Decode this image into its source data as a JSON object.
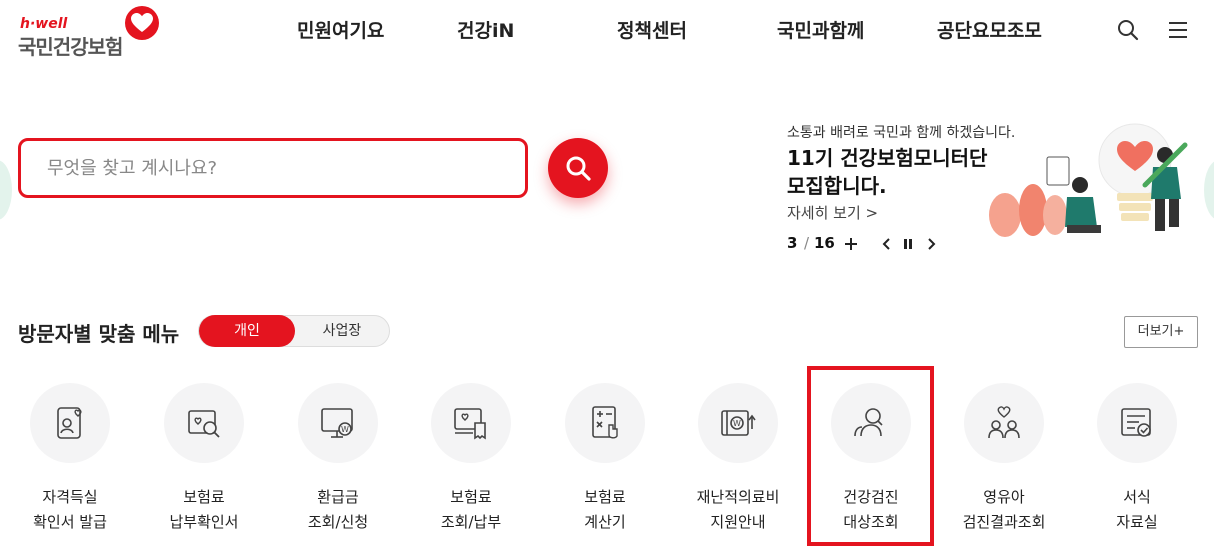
{
  "header": {
    "logo_tagline": "h·well",
    "logo_text": "국민건강보험",
    "nav": [
      "민원여기요",
      "건강iN",
      "정책센터",
      "국민과함께",
      "공단요모조모"
    ],
    "icons": [
      "search-icon",
      "hamburger-menu-icon"
    ]
  },
  "search": {
    "placeholder": "무엇을 찾고 계시나요?"
  },
  "banner": {
    "subtitle": "소통과 배려로 국민과 함께 하겠습니다.",
    "title": "11기 건강보험모니터단\n모집합니다.",
    "link": "자세히 보기 >",
    "pager_current": "3",
    "pager_sep": "/",
    "pager_total": "16"
  },
  "visitor_menu": {
    "title": "방문자별 맞춤 메뉴",
    "toggle_on": "개인",
    "toggle_off": "사업장",
    "more": "더보기+",
    "items": [
      {
        "label": "자격득실\n확인서 발급",
        "icon": "id-card-icon"
      },
      {
        "label": "보험료\n납부확인서",
        "icon": "document-search-icon"
      },
      {
        "label": "환급금\n조회/신청",
        "icon": "monitor-won-icon"
      },
      {
        "label": "보험료\n조회/납부",
        "icon": "receipt-icon"
      },
      {
        "label": "보험료\n계산기",
        "icon": "calculator-icon"
      },
      {
        "label": "재난적의료비\n지원안내",
        "icon": "won-support-icon"
      },
      {
        "label": "건강검진\n대상조회",
        "icon": "user-search-icon"
      },
      {
        "label": "영유아\n검진결과조회",
        "icon": "family-heart-icon"
      },
      {
        "label": "서식\n자료실",
        "icon": "form-document-icon"
      }
    ]
  },
  "colors": {
    "brand_red": "#e4141f",
    "text_dark": "#222222",
    "circle_bg": "#f4f4f5"
  }
}
